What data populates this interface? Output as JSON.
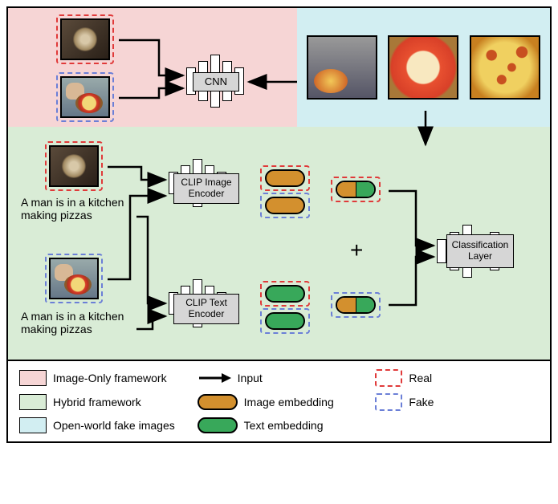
{
  "modules": {
    "cnn": "CNN",
    "clip_image": "CLIP Image Encoder",
    "clip_text": "CLIP Text Encoder",
    "classifier": "Classification Layer"
  },
  "captions": {
    "top": "A man is in a kitchen making pizzas",
    "bottom": "A man is in a kitchen making pizzas"
  },
  "plus": "+",
  "legend": {
    "image_only": "Image-Only framework",
    "hybrid": "Hybrid framework",
    "open_world": "Open-world fake images",
    "input": "Input",
    "image_emb": "Image embedding",
    "text_emb": "Text embedding",
    "real": "Real",
    "fake": "Fake"
  }
}
